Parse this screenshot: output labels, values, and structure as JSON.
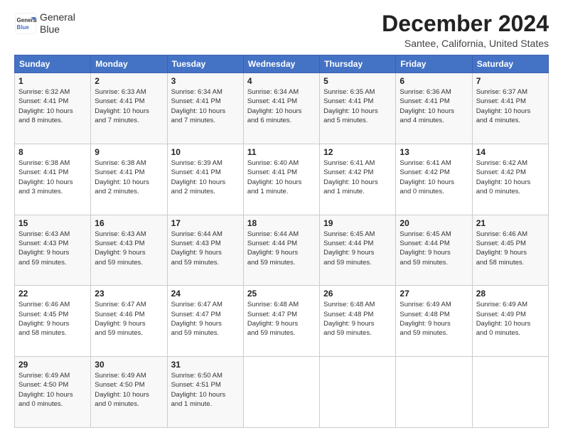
{
  "logo": {
    "line1": "General",
    "line2": "Blue"
  },
  "title": "December 2024",
  "subtitle": "Santee, California, United States",
  "days_of_week": [
    "Sunday",
    "Monday",
    "Tuesday",
    "Wednesday",
    "Thursday",
    "Friday",
    "Saturday"
  ],
  "weeks": [
    [
      {
        "day": 1,
        "sunrise": "6:32 AM",
        "sunset": "4:41 PM",
        "daylight": "10 hours and 8 minutes."
      },
      {
        "day": 2,
        "sunrise": "6:33 AM",
        "sunset": "4:41 PM",
        "daylight": "10 hours and 7 minutes."
      },
      {
        "day": 3,
        "sunrise": "6:34 AM",
        "sunset": "4:41 PM",
        "daylight": "10 hours and 7 minutes."
      },
      {
        "day": 4,
        "sunrise": "6:34 AM",
        "sunset": "4:41 PM",
        "daylight": "10 hours and 6 minutes."
      },
      {
        "day": 5,
        "sunrise": "6:35 AM",
        "sunset": "4:41 PM",
        "daylight": "10 hours and 5 minutes."
      },
      {
        "day": 6,
        "sunrise": "6:36 AM",
        "sunset": "4:41 PM",
        "daylight": "10 hours and 4 minutes."
      },
      {
        "day": 7,
        "sunrise": "6:37 AM",
        "sunset": "4:41 PM",
        "daylight": "10 hours and 4 minutes."
      }
    ],
    [
      {
        "day": 8,
        "sunrise": "6:38 AM",
        "sunset": "4:41 PM",
        "daylight": "10 hours and 3 minutes."
      },
      {
        "day": 9,
        "sunrise": "6:38 AM",
        "sunset": "4:41 PM",
        "daylight": "10 hours and 2 minutes."
      },
      {
        "day": 10,
        "sunrise": "6:39 AM",
        "sunset": "4:41 PM",
        "daylight": "10 hours and 2 minutes."
      },
      {
        "day": 11,
        "sunrise": "6:40 AM",
        "sunset": "4:41 PM",
        "daylight": "10 hours and 1 minute."
      },
      {
        "day": 12,
        "sunrise": "6:41 AM",
        "sunset": "4:42 PM",
        "daylight": "10 hours and 1 minute."
      },
      {
        "day": 13,
        "sunrise": "6:41 AM",
        "sunset": "4:42 PM",
        "daylight": "10 hours and 0 minutes."
      },
      {
        "day": 14,
        "sunrise": "6:42 AM",
        "sunset": "4:42 PM",
        "daylight": "10 hours and 0 minutes."
      }
    ],
    [
      {
        "day": 15,
        "sunrise": "6:43 AM",
        "sunset": "4:43 PM",
        "daylight": "9 hours and 59 minutes."
      },
      {
        "day": 16,
        "sunrise": "6:43 AM",
        "sunset": "4:43 PM",
        "daylight": "9 hours and 59 minutes."
      },
      {
        "day": 17,
        "sunrise": "6:44 AM",
        "sunset": "4:43 PM",
        "daylight": "9 hours and 59 minutes."
      },
      {
        "day": 18,
        "sunrise": "6:44 AM",
        "sunset": "4:44 PM",
        "daylight": "9 hours and 59 minutes."
      },
      {
        "day": 19,
        "sunrise": "6:45 AM",
        "sunset": "4:44 PM",
        "daylight": "9 hours and 59 minutes."
      },
      {
        "day": 20,
        "sunrise": "6:45 AM",
        "sunset": "4:44 PM",
        "daylight": "9 hours and 59 minutes."
      },
      {
        "day": 21,
        "sunrise": "6:46 AM",
        "sunset": "4:45 PM",
        "daylight": "9 hours and 58 minutes."
      }
    ],
    [
      {
        "day": 22,
        "sunrise": "6:46 AM",
        "sunset": "4:45 PM",
        "daylight": "9 hours and 58 minutes."
      },
      {
        "day": 23,
        "sunrise": "6:47 AM",
        "sunset": "4:46 PM",
        "daylight": "9 hours and 59 minutes."
      },
      {
        "day": 24,
        "sunrise": "6:47 AM",
        "sunset": "4:47 PM",
        "daylight": "9 hours and 59 minutes."
      },
      {
        "day": 25,
        "sunrise": "6:48 AM",
        "sunset": "4:47 PM",
        "daylight": "9 hours and 59 minutes."
      },
      {
        "day": 26,
        "sunrise": "6:48 AM",
        "sunset": "4:48 PM",
        "daylight": "9 hours and 59 minutes."
      },
      {
        "day": 27,
        "sunrise": "6:49 AM",
        "sunset": "4:48 PM",
        "daylight": "9 hours and 59 minutes."
      },
      {
        "day": 28,
        "sunrise": "6:49 AM",
        "sunset": "4:49 PM",
        "daylight": "10 hours and 0 minutes."
      }
    ],
    [
      {
        "day": 29,
        "sunrise": "6:49 AM",
        "sunset": "4:50 PM",
        "daylight": "10 hours and 0 minutes."
      },
      {
        "day": 30,
        "sunrise": "6:49 AM",
        "sunset": "4:50 PM",
        "daylight": "10 hours and 0 minutes."
      },
      {
        "day": 31,
        "sunrise": "6:50 AM",
        "sunset": "4:51 PM",
        "daylight": "10 hours and 1 minute."
      },
      null,
      null,
      null,
      null
    ]
  ]
}
